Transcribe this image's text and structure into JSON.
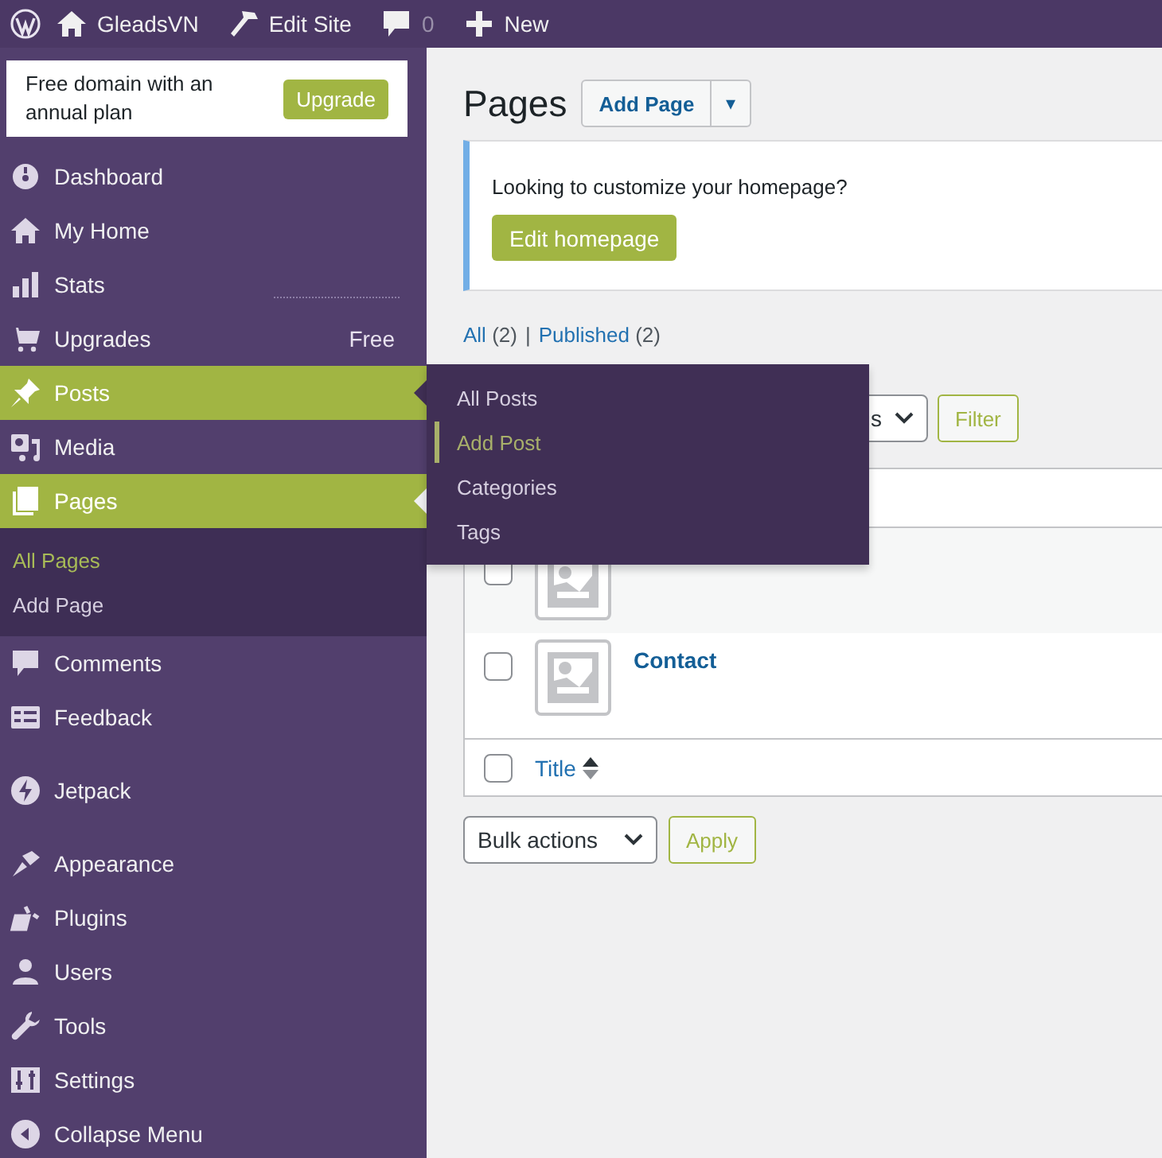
{
  "admin_bar": {
    "items": [
      {
        "label": "GleadsVN"
      },
      {
        "label": "Edit Site"
      },
      {
        "label": "0"
      },
      {
        "label": "New"
      }
    ]
  },
  "upgrade_banner": {
    "text": "Free domain with an annual plan",
    "button": "Upgrade"
  },
  "sidebar": {
    "groups": [
      {
        "items": [
          {
            "label": "Dashboard",
            "selected": false,
            "flyout_open": false
          },
          {
            "label": "My Home",
            "selected": false,
            "flyout_open": false
          },
          {
            "label": "Stats",
            "selected": false,
            "flyout_open": false
          },
          {
            "label": "Upgrades",
            "badge": "Free",
            "selected": false,
            "flyout_open": false
          },
          {
            "label": "Posts",
            "selected": false,
            "flyout_open": true
          },
          {
            "label": "Media",
            "selected": false,
            "flyout_open": false
          },
          {
            "label": "Pages",
            "selected": true,
            "flyout_open": false,
            "children": [
              {
                "label": "All Pages",
                "selected": true
              },
              {
                "label": "Add Page",
                "selected": false
              }
            ]
          },
          {
            "label": "Comments",
            "selected": false,
            "flyout_open": false
          },
          {
            "label": "Feedback",
            "selected": false,
            "flyout_open": false
          }
        ]
      },
      {
        "items": [
          {
            "label": "Jetpack",
            "selected": false,
            "flyout_open": false
          }
        ]
      },
      {
        "items": [
          {
            "label": "Appearance",
            "selected": false,
            "flyout_open": false
          },
          {
            "label": "Plugins",
            "selected": false,
            "flyout_open": false
          },
          {
            "label": "Users",
            "selected": false,
            "flyout_open": false
          },
          {
            "label": "Tools",
            "selected": false,
            "flyout_open": false
          },
          {
            "label": "Settings",
            "selected": false,
            "flyout_open": false
          },
          {
            "label": "Collapse Menu",
            "selected": false,
            "flyout_open": false
          }
        ]
      }
    ]
  },
  "flyout": {
    "items": [
      {
        "label": "All Posts",
        "selected": false
      },
      {
        "label": "Add Post",
        "selected": true
      },
      {
        "label": "Categories",
        "selected": false
      },
      {
        "label": "Tags",
        "selected": false
      }
    ]
  },
  "page": {
    "title": "Pages",
    "add_button": "Add Page",
    "dropdown_button": "▾",
    "notice": {
      "text": "Looking to customize your homepage?",
      "button": "Edit homepage"
    },
    "filters": [
      {
        "label": "All",
        "count": "(2)"
      },
      {
        "separator": "|",
        "label": "Published",
        "count": "(2)"
      }
    ],
    "filter_select": "s",
    "filter_button": "Filter",
    "rows": [
      {
        "checked": false
      },
      {
        "title": "Contact",
        "checked": false
      }
    ],
    "footer_column": "Title",
    "footer_checked": false,
    "bulk_select": "Bulk actions",
    "apply_button": "Apply"
  }
}
